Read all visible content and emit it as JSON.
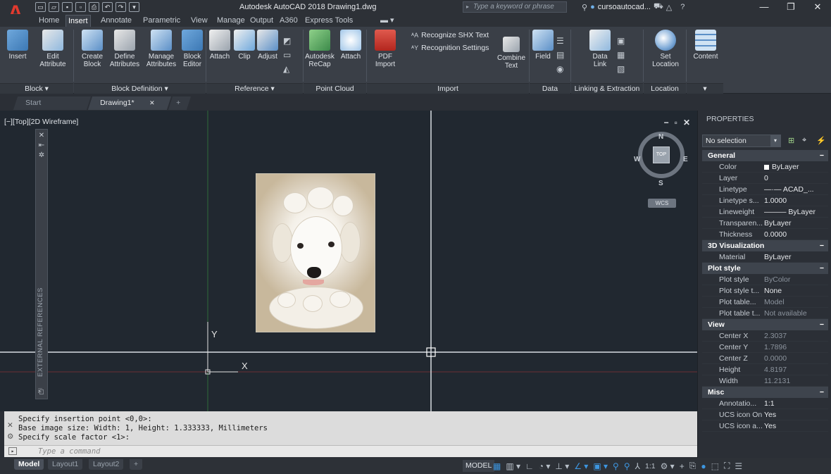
{
  "window": {
    "title": "Autodesk AutoCAD 2018   Drawing1.dwg",
    "logo": "A",
    "search_placeholder": "Type a keyword or phrase",
    "user": "cursoautocad...",
    "controls": {
      "minimize": "—",
      "restore": "❐",
      "close": "✕"
    }
  },
  "ribbon_tabs": [
    "Home",
    "Insert",
    "Annotate",
    "Parametric",
    "View",
    "Manage",
    "Output",
    "A360",
    "Express Tools"
  ],
  "active_tab": "Insert",
  "ribbon": {
    "block": {
      "insert": "Insert",
      "edit_attribute_1": "Edit",
      "edit_attribute_2": "Attribute",
      "label": "Block ▾"
    },
    "block_definition": {
      "create_1": "Create",
      "create_2": "Block",
      "define_1": "Define",
      "define_2": "Attributes",
      "manage_1": "Manage",
      "manage_2": "Attributes",
      "editor_1": "Block",
      "editor_2": "Editor",
      "label": "Block Definition ▾"
    },
    "reference": {
      "attach": "Attach",
      "clip": "Clip",
      "adjust": "Adjust",
      "label": "Reference ▾"
    },
    "point_cloud": {
      "recap_1": "Autodesk",
      "recap_2": "ReCap",
      "attach": "Attach",
      "label": "Point Cloud"
    },
    "import": {
      "pdf_1": "PDF",
      "pdf_2": "Import",
      "recognize_shx": "Recognize SHX Text",
      "recognition_settings": "Recognition Settings",
      "combine_1": "Combine",
      "combine_2": "Text",
      "label": "Import"
    },
    "data": {
      "field": "Field",
      "label": "Data"
    },
    "linking": {
      "data_link_1": "Data",
      "data_link_2": "Link",
      "label": "Linking & Extraction"
    },
    "location": {
      "set_1": "Set",
      "set_2": "Location",
      "label": "Location"
    },
    "content": {
      "content": "Content",
      "label": "▾"
    }
  },
  "doc_tabs": {
    "start": "Start",
    "drawing": "Drawing1*",
    "close": "✕",
    "new": "+"
  },
  "viewport": {
    "view_label": "[−][Top][2D Wireframe]",
    "controls": [
      "−",
      "▫",
      "✕"
    ],
    "xref_palette": "EXTERNAL REFERENCES",
    "compass": {
      "n": "N",
      "s": "S",
      "e": "E",
      "w": "W",
      "top": "TOP",
      "wcs": "WCS"
    },
    "ucs_x": "X",
    "ucs_y": "Y"
  },
  "command": {
    "history": [
      "Specify insertion point <0,0>:",
      "Base image size: Width: 1, Height: 1.333333, Millimeters",
      "Specify scale factor <1>:"
    ],
    "input_placeholder": "Type a command"
  },
  "layout_tabs": [
    "Model",
    "Layout1",
    "Layout2",
    "+"
  ],
  "status": {
    "model": "MODEL",
    "scale": "1:1"
  },
  "properties": {
    "title": "PROPERTIES",
    "selection": "No selection",
    "sections": [
      {
        "name": "General",
        "rows": [
          {
            "name": "Color",
            "value": "ByLayer",
            "swatch": true
          },
          {
            "name": "Layer",
            "value": "0"
          },
          {
            "name": "Linetype",
            "value": "—·— ACAD_..."
          },
          {
            "name": "Linetype s...",
            "value": "1.0000"
          },
          {
            "name": "Lineweight",
            "value": "——— ByLayer"
          },
          {
            "name": "Transparen...",
            "value": "ByLayer"
          },
          {
            "name": "Thickness",
            "value": "0.0000"
          }
        ]
      },
      {
        "name": "3D Visualization",
        "rows": [
          {
            "name": "Material",
            "value": "ByLayer"
          }
        ]
      },
      {
        "name": "Plot style",
        "rows": [
          {
            "name": "Plot style",
            "value": "ByColor",
            "dim": true
          },
          {
            "name": "Plot style t...",
            "value": "None"
          },
          {
            "name": "Plot table...",
            "value": "Model",
            "dim": true
          },
          {
            "name": "Plot table t...",
            "value": "Not available",
            "dim": true
          }
        ]
      },
      {
        "name": "View",
        "rows": [
          {
            "name": "Center X",
            "value": "2.3037",
            "dim": true
          },
          {
            "name": "Center Y",
            "value": "1.7896",
            "dim": true
          },
          {
            "name": "Center Z",
            "value": "0.0000",
            "dim": true
          },
          {
            "name": "Height",
            "value": "4.8197",
            "dim": true
          },
          {
            "name": "Width",
            "value": "11.2131",
            "dim": true
          }
        ]
      },
      {
        "name": "Misc",
        "rows": [
          {
            "name": "Annotatio...",
            "value": "1:1"
          },
          {
            "name": "UCS icon On",
            "value": "Yes"
          },
          {
            "name": "UCS icon a...",
            "value": "Yes"
          }
        ]
      }
    ]
  }
}
